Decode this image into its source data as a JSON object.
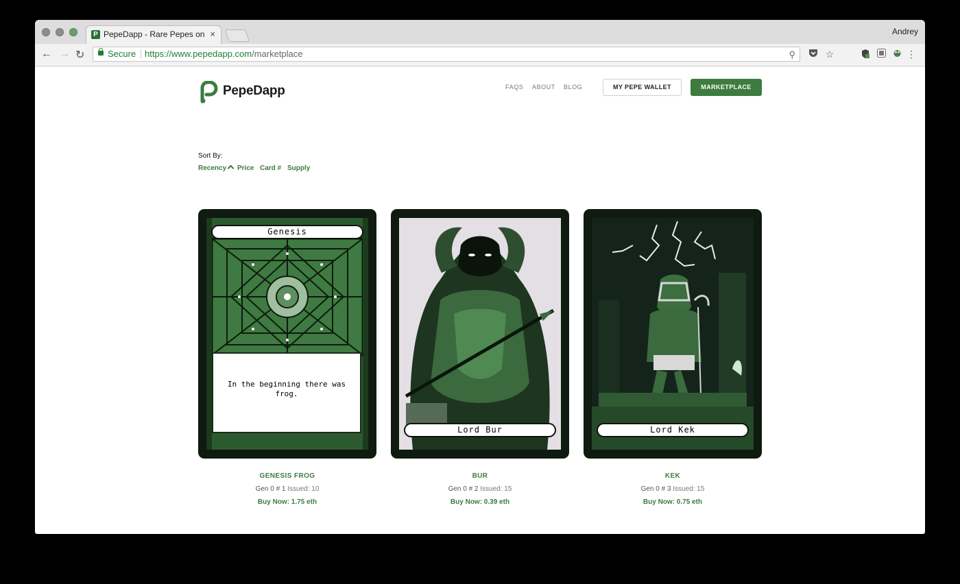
{
  "browser": {
    "tab_title": "PepeDapp - Rare Pepes on ETH",
    "tab_close": "×",
    "profile_name": "Andrey",
    "secure_label": "Secure",
    "url_host": "https://www.pepedapp.com",
    "url_path": "/marketplace"
  },
  "site": {
    "logo_text": "PepeDapp",
    "brand_color": "#3d7b3f",
    "nav": [
      "FAQS",
      "ABOUT",
      "BLOG"
    ],
    "wallet_button": "MY PEPE WALLET",
    "marketplace_button": "MARKETPLACE"
  },
  "sort": {
    "label": "Sort By:",
    "options": [
      "Recency",
      "Price",
      "Card #",
      "Supply"
    ],
    "active": "Recency"
  },
  "cards": [
    {
      "card_title": "Genesis",
      "flavor": "In the beginning there was frog.",
      "name": "GENESIS FROG",
      "gen": "Gen 0 # 1",
      "issued": "Issued: 10",
      "price": "Buy Now: 1.75 eth"
    },
    {
      "card_title": "Lord Bur",
      "name": "BUR",
      "gen": "Gen 0 # 2",
      "issued": "Issued: 15",
      "price": "Buy Now: 0.39 eth"
    },
    {
      "card_title": "Lord Kek",
      "name": "KEK",
      "gen": "Gen 0 # 3",
      "issued": "Issued: 15",
      "price": "Buy Now: 0.75 eth"
    }
  ]
}
